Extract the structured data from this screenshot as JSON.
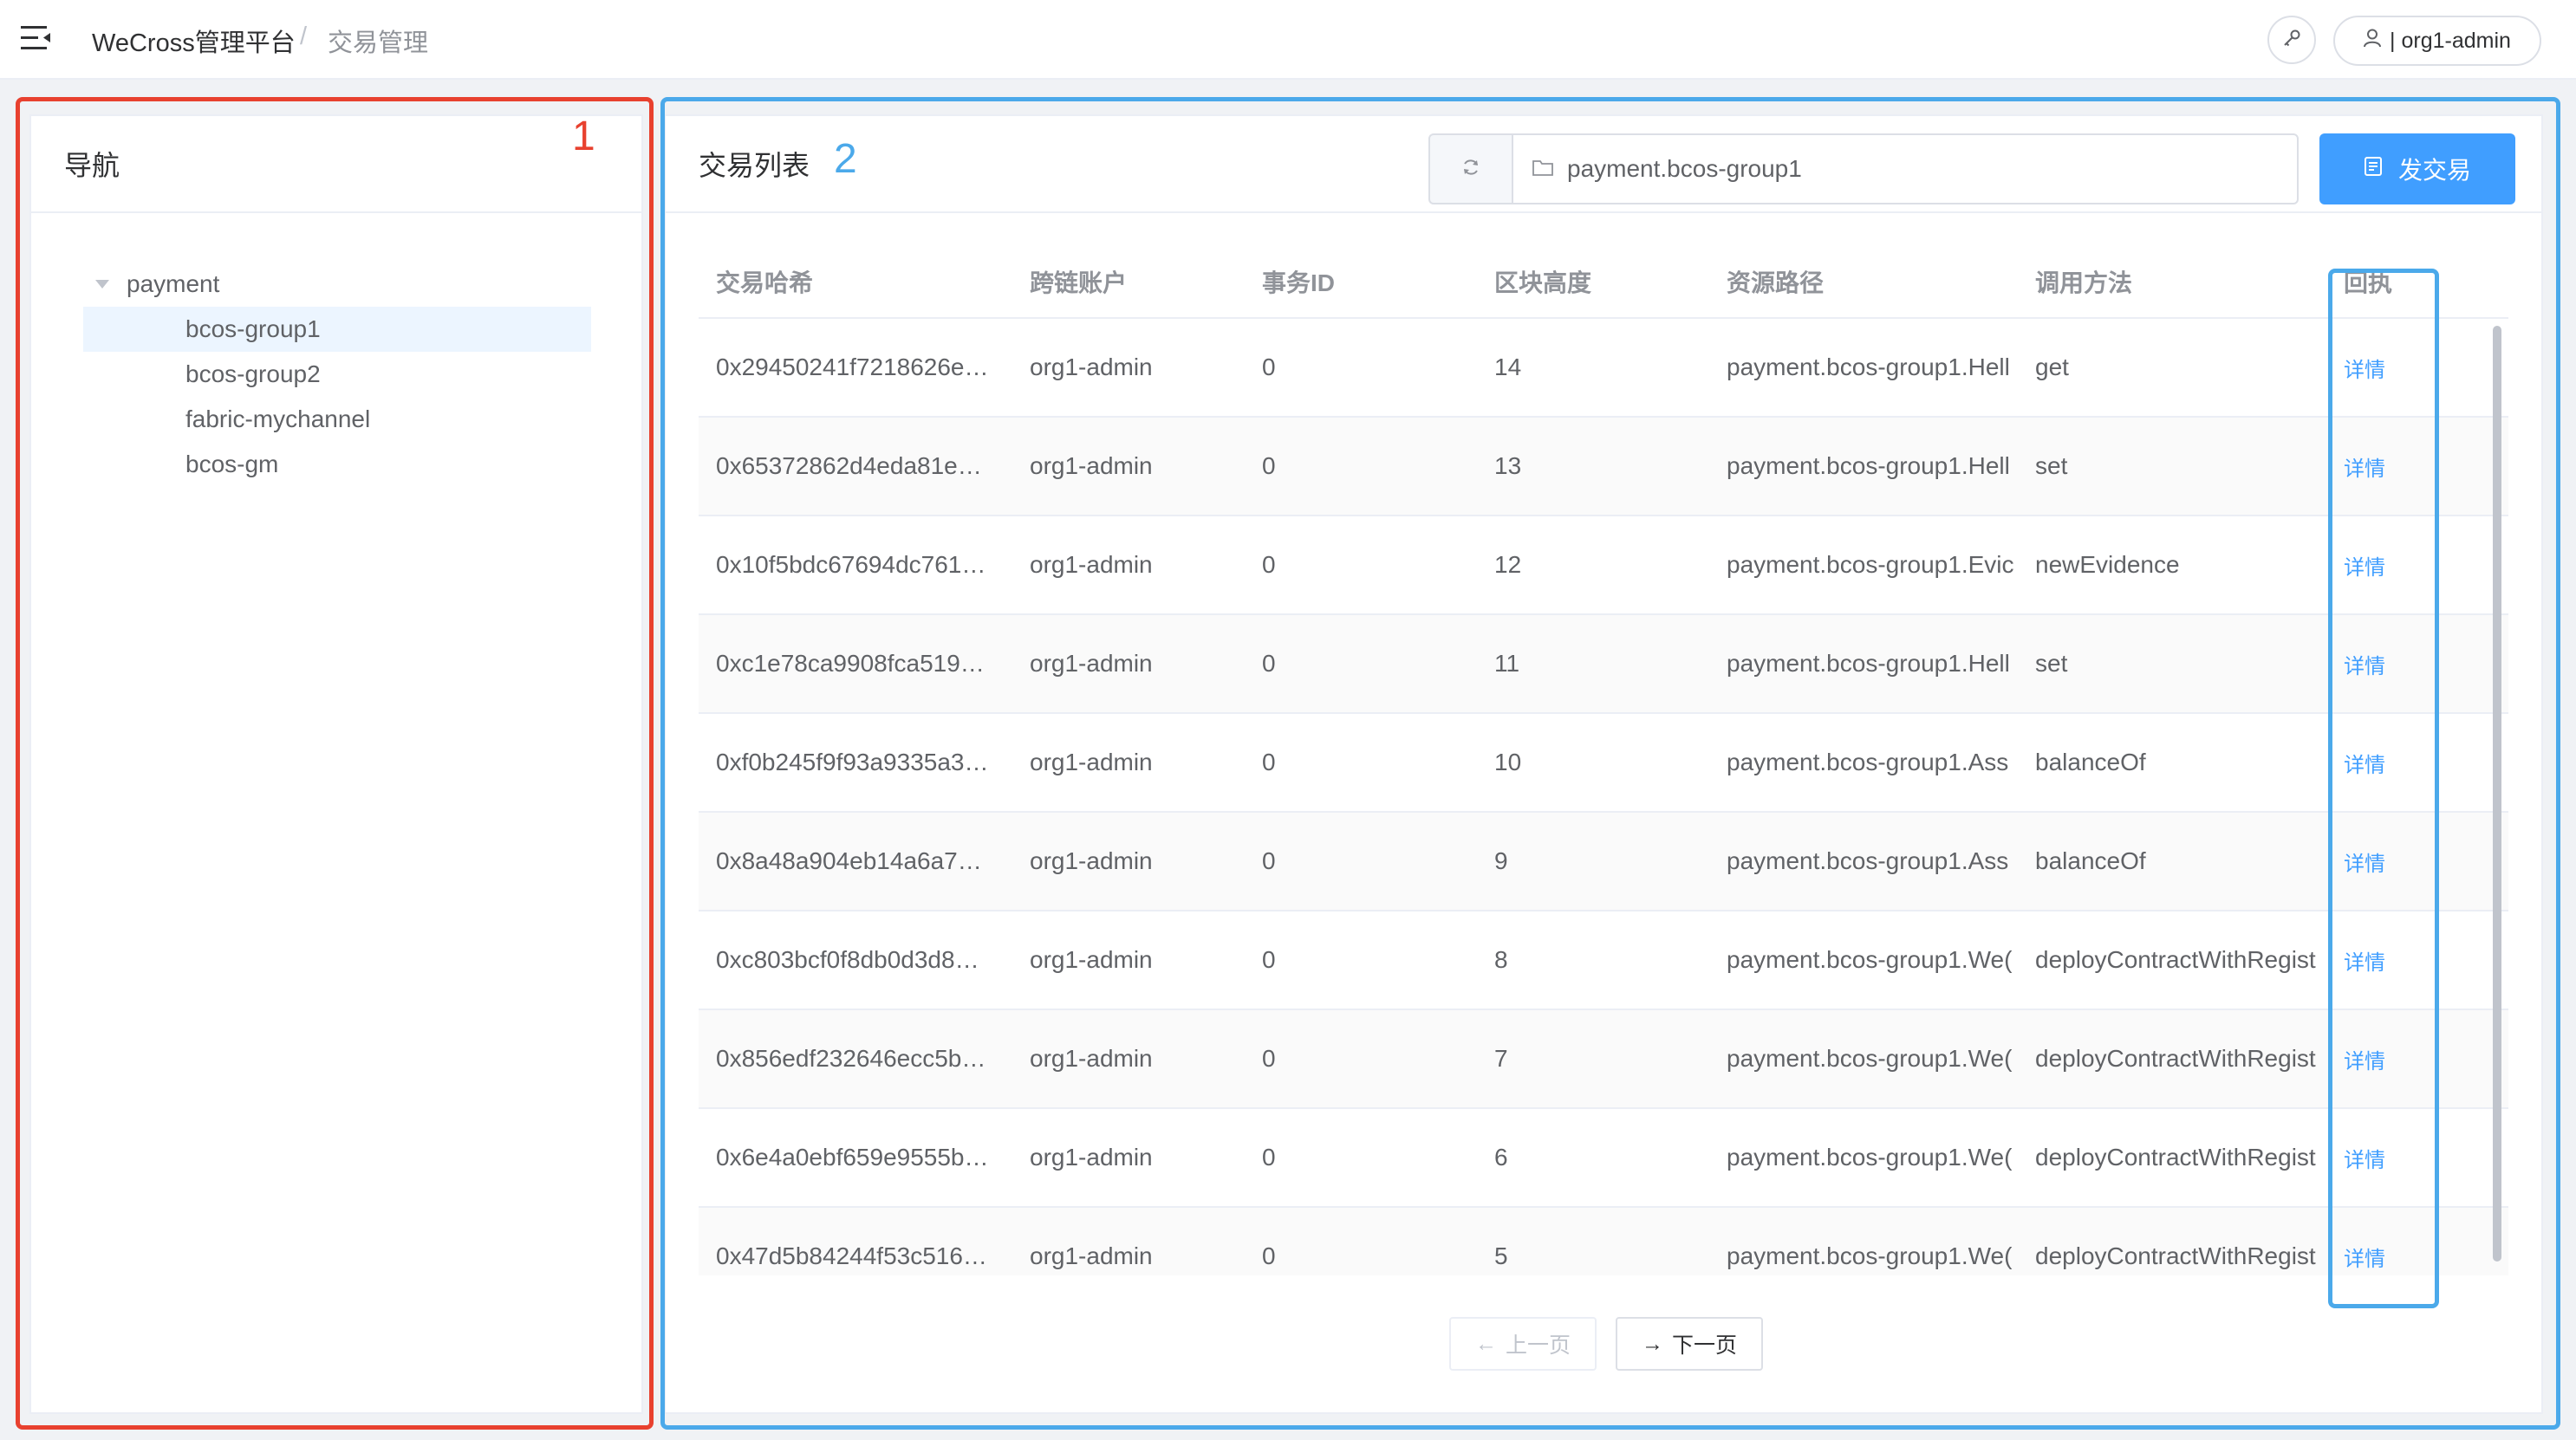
{
  "header": {
    "brand": "WeCross管理平台",
    "separator": "/",
    "breadcrumb": "交易管理",
    "user_label": "| org1-admin"
  },
  "nav": {
    "title": "导航",
    "root": "payment",
    "children": [
      "bcos-group1",
      "bcos-group2",
      "fabric-mychannel",
      "bcos-gm"
    ],
    "selected": "bcos-group1"
  },
  "main": {
    "title": "交易列表",
    "path_value": "payment.bcos-group1",
    "send_label": "发交易",
    "columns": [
      "交易哈希",
      "跨链账户",
      "事务ID",
      "区块高度",
      "资源路径",
      "调用方法",
      "回执"
    ],
    "rows": [
      {
        "hash": "0x29450241f7218626e…",
        "account": "org1-admin",
        "tx_id": "0",
        "height": "14",
        "path": "payment.bcos-group1.Hell",
        "method": "get",
        "receipt": "详情"
      },
      {
        "hash": "0x65372862d4eda81e…",
        "account": "org1-admin",
        "tx_id": "0",
        "height": "13",
        "path": "payment.bcos-group1.Hell",
        "method": "set",
        "receipt": "详情"
      },
      {
        "hash": "0x10f5bdc67694dc761…",
        "account": "org1-admin",
        "tx_id": "0",
        "height": "12",
        "path": "payment.bcos-group1.Evic",
        "method": "newEvidence",
        "receipt": "详情"
      },
      {
        "hash": "0xc1e78ca9908fca519…",
        "account": "org1-admin",
        "tx_id": "0",
        "height": "11",
        "path": "payment.bcos-group1.Hell",
        "method": "set",
        "receipt": "详情"
      },
      {
        "hash": "0xf0b245f9f93a9335a3…",
        "account": "org1-admin",
        "tx_id": "0",
        "height": "10",
        "path": "payment.bcos-group1.Ass",
        "method": "balanceOf",
        "receipt": "详情"
      },
      {
        "hash": "0x8a48a904eb14a6a7…",
        "account": "org1-admin",
        "tx_id": "0",
        "height": "9",
        "path": "payment.bcos-group1.Ass",
        "method": "balanceOf",
        "receipt": "详情"
      },
      {
        "hash": "0xc803bcf0f8db0d3d8…",
        "account": "org1-admin",
        "tx_id": "0",
        "height": "8",
        "path": "payment.bcos-group1.We(",
        "method": "deployContractWithRegist",
        "receipt": "详情"
      },
      {
        "hash": "0x856edf232646ecc5b…",
        "account": "org1-admin",
        "tx_id": "0",
        "height": "7",
        "path": "payment.bcos-group1.We(",
        "method": "deployContractWithRegist",
        "receipt": "详情"
      },
      {
        "hash": "0x6e4a0ebf659e9555b…",
        "account": "org1-admin",
        "tx_id": "0",
        "height": "6",
        "path": "payment.bcos-group1.We(",
        "method": "deployContractWithRegist",
        "receipt": "详情"
      },
      {
        "hash": "0x47d5b84244f53c516…",
        "account": "org1-admin",
        "tx_id": "0",
        "height": "5",
        "path": "payment.bcos-group1.We(",
        "method": "deployContractWithRegist",
        "receipt": "详情"
      }
    ],
    "prev_label": "上一页",
    "next_label": "下一页"
  },
  "annotations": {
    "label_1": "1",
    "label_2": "2",
    "color_red": "#e8412f",
    "color_blue": "#4ba9ea"
  },
  "colors": {
    "accent": "#409eff",
    "selected_bg": "#ecf5ff"
  }
}
